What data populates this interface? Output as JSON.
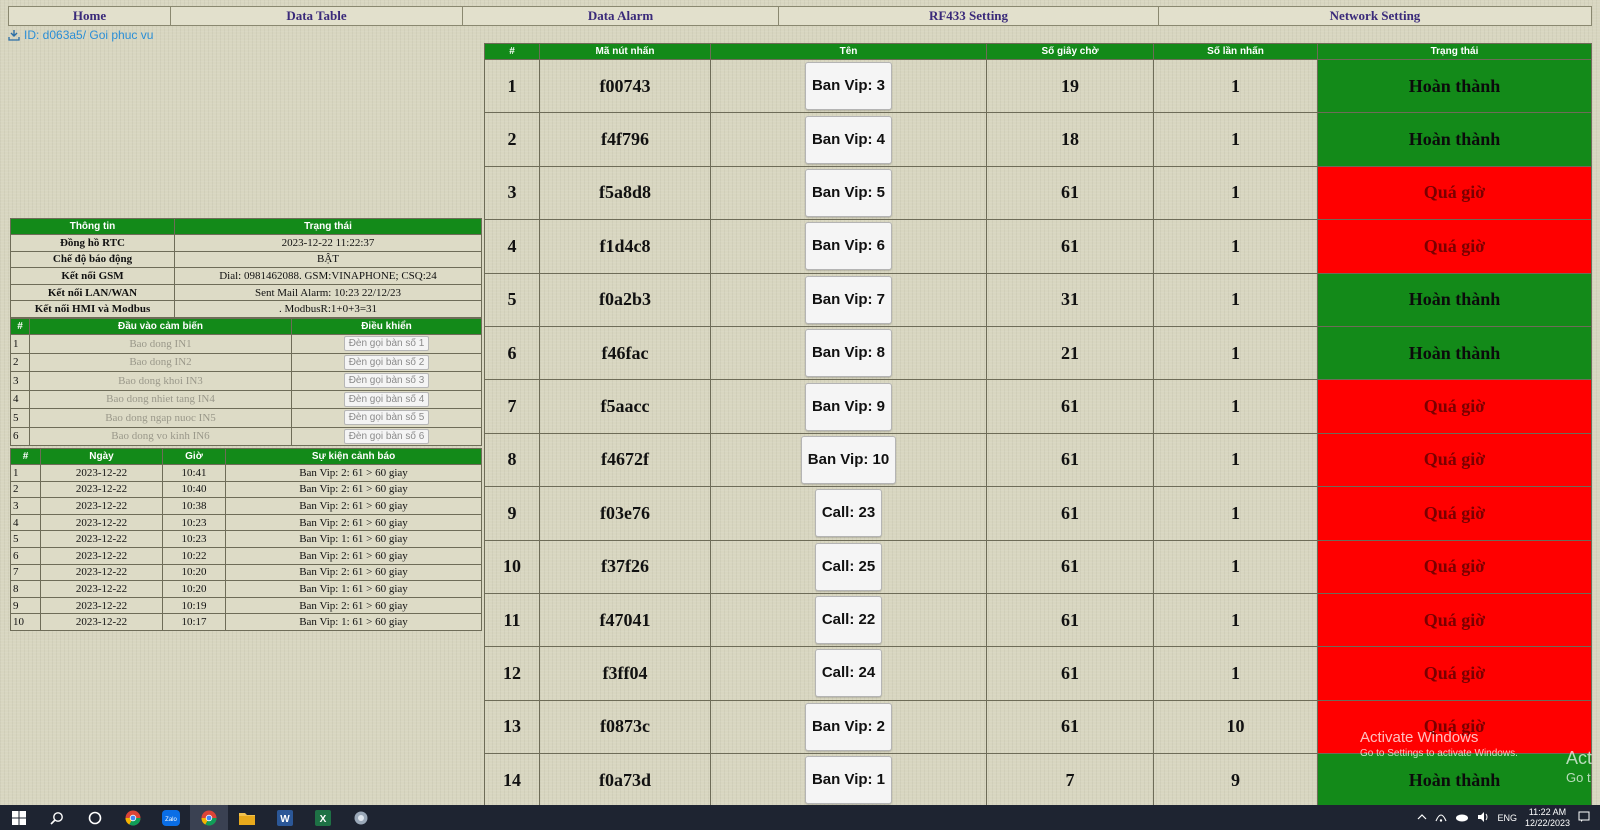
{
  "nav": {
    "items": [
      "Home",
      "Data Table",
      "Data Alarm",
      "RF433 Setting",
      "Network Setting"
    ]
  },
  "device_id": "ID: d063a5/ Goi phuc vu",
  "info_table": {
    "headers": [
      "Thông tin",
      "Trạng thái"
    ],
    "rows": [
      {
        "key": "Đồng hồ RTC",
        "value": "2023-12-22 11:22:37"
      },
      {
        "key": "Chế độ báo động",
        "value": "BẬT"
      },
      {
        "key": "Kết nối GSM",
        "value": "Dial: 0981462088. GSM:VINAPHONE; CSQ:24"
      },
      {
        "key": "Kết nối LAN/WAN",
        "value": "Sent Mail Alarm: 10:23 22/12/23"
      },
      {
        "key": "Kết nối HMI và Modbus",
        "value": ". ModbusR:1+0+3=31"
      }
    ]
  },
  "sensor_table": {
    "headers": [
      "#",
      "Đầu vào cảm biến",
      "Điều khiển"
    ],
    "rows": [
      {
        "idx": "1",
        "name": "Bao dong IN1",
        "control": "Đèn gọi bàn số 1"
      },
      {
        "idx": "2",
        "name": "Bao dong IN2",
        "control": "Đèn gọi bàn số 2"
      },
      {
        "idx": "3",
        "name": "Bao dong khoi IN3",
        "control": "Đèn gọi bàn số 3"
      },
      {
        "idx": "4",
        "name": "Bao dong nhiet tang IN4",
        "control": "Đèn gọi bàn số 4"
      },
      {
        "idx": "5",
        "name": "Bao dong ngap nuoc IN5",
        "control": "Đèn gọi bàn số 5"
      },
      {
        "idx": "6",
        "name": "Bao dong vo kinh IN6",
        "control": "Đèn gọi bàn số 6"
      }
    ]
  },
  "event_table": {
    "headers": [
      "#",
      "Ngày",
      "Giờ",
      "Sự kiện cảnh báo"
    ],
    "rows": [
      {
        "idx": "1",
        "date": "2023-12-22",
        "time": "10:41",
        "event": "Ban Vip: 2: 61 > 60 giay"
      },
      {
        "idx": "2",
        "date": "2023-12-22",
        "time": "10:40",
        "event": "Ban Vip: 2: 61 > 60 giay"
      },
      {
        "idx": "3",
        "date": "2023-12-22",
        "time": "10:38",
        "event": "Ban Vip: 2: 61 > 60 giay"
      },
      {
        "idx": "4",
        "date": "2023-12-22",
        "time": "10:23",
        "event": "Ban Vip: 2: 61 > 60 giay"
      },
      {
        "idx": "5",
        "date": "2023-12-22",
        "time": "10:23",
        "event": "Ban Vip: 1: 61 > 60 giay"
      },
      {
        "idx": "6",
        "date": "2023-12-22",
        "time": "10:22",
        "event": "Ban Vip: 2: 61 > 60 giay"
      },
      {
        "idx": "7",
        "date": "2023-12-22",
        "time": "10:20",
        "event": "Ban Vip: 2: 61 > 60 giay"
      },
      {
        "idx": "8",
        "date": "2023-12-22",
        "time": "10:20",
        "event": "Ban Vip: 1: 61 > 60 giay"
      },
      {
        "idx": "9",
        "date": "2023-12-22",
        "time": "10:19",
        "event": "Ban Vip: 2: 61 > 60 giay"
      },
      {
        "idx": "10",
        "date": "2023-12-22",
        "time": "10:17",
        "event": "Ban Vip: 1: 61 > 60 giay"
      }
    ]
  },
  "main_table": {
    "headers": [
      "#",
      "Mã nút nhấn",
      "Tên",
      "Số giây chờ",
      "Số lần nhấn",
      "Trạng thái"
    ],
    "rows": [
      {
        "idx": "1",
        "code": "f00743",
        "name": "Ban Vip: 3",
        "wait": "19",
        "presses": "1",
        "status": "Hoàn thành",
        "state": "done"
      },
      {
        "idx": "2",
        "code": "f4f796",
        "name": "Ban Vip: 4",
        "wait": "18",
        "presses": "1",
        "status": "Hoàn thành",
        "state": "done"
      },
      {
        "idx": "3",
        "code": "f5a8d8",
        "name": "Ban Vip: 5",
        "wait": "61",
        "presses": "1",
        "status": "Quá giờ",
        "state": "late"
      },
      {
        "idx": "4",
        "code": "f1d4c8",
        "name": "Ban Vip: 6",
        "wait": "61",
        "presses": "1",
        "status": "Quá giờ",
        "state": "late"
      },
      {
        "idx": "5",
        "code": "f0a2b3",
        "name": "Ban Vip: 7",
        "wait": "31",
        "presses": "1",
        "status": "Hoàn thành",
        "state": "done"
      },
      {
        "idx": "6",
        "code": "f46fac",
        "name": "Ban Vip: 8",
        "wait": "21",
        "presses": "1",
        "status": "Hoàn thành",
        "state": "done"
      },
      {
        "idx": "7",
        "code": "f5aacc",
        "name": "Ban Vip: 9",
        "wait": "61",
        "presses": "1",
        "status": "Quá giờ",
        "state": "late"
      },
      {
        "idx": "8",
        "code": "f4672f",
        "name": "Ban Vip: 10",
        "wait": "61",
        "presses": "1",
        "status": "Quá giờ",
        "state": "late"
      },
      {
        "idx": "9",
        "code": "f03e76",
        "name": "Call: 23",
        "wait": "61",
        "presses": "1",
        "status": "Quá giờ",
        "state": "late"
      },
      {
        "idx": "10",
        "code": "f37f26",
        "name": "Call: 25",
        "wait": "61",
        "presses": "1",
        "status": "Quá giờ",
        "state": "late"
      },
      {
        "idx": "11",
        "code": "f47041",
        "name": "Call: 22",
        "wait": "61",
        "presses": "1",
        "status": "Quá giờ",
        "state": "late"
      },
      {
        "idx": "12",
        "code": "f3ff04",
        "name": "Call: 24",
        "wait": "61",
        "presses": "1",
        "status": "Quá giờ",
        "state": "late"
      },
      {
        "idx": "13",
        "code": "f0873c",
        "name": "Ban Vip: 2",
        "wait": "61",
        "presses": "10",
        "status": "Quá giờ",
        "state": "late"
      },
      {
        "idx": "14",
        "code": "f0a73d",
        "name": "Ban Vip: 1",
        "wait": "7",
        "presses": "9",
        "status": "Hoàn thành",
        "state": "done"
      }
    ]
  },
  "colors": {
    "header_green": "#138a19",
    "status_done": "#138a19",
    "status_late": "#ff0000",
    "nav_text": "#3a2a7a",
    "id_text": "#2a8ed6",
    "taskbar": "#1e2431"
  },
  "watermark": {
    "title": "Activate Windows",
    "subtitle": "Go to Settings to activate Windows.",
    "edge_1": "Act",
    "edge_2": "Go t"
  },
  "taskbar": {
    "icons": [
      "windows-start-icon",
      "search-icon",
      "cortana-icon",
      "chrome-icon",
      "zalo-icon",
      "chrome-profile-icon",
      "file-explorer-icon",
      "word-icon",
      "excel-icon",
      "app-icon"
    ],
    "zalo_label": "Zalo",
    "word_label": "W",
    "excel_label": "X",
    "lang": "ENG",
    "time": "11:22 AM",
    "date": "12/22/2023"
  }
}
